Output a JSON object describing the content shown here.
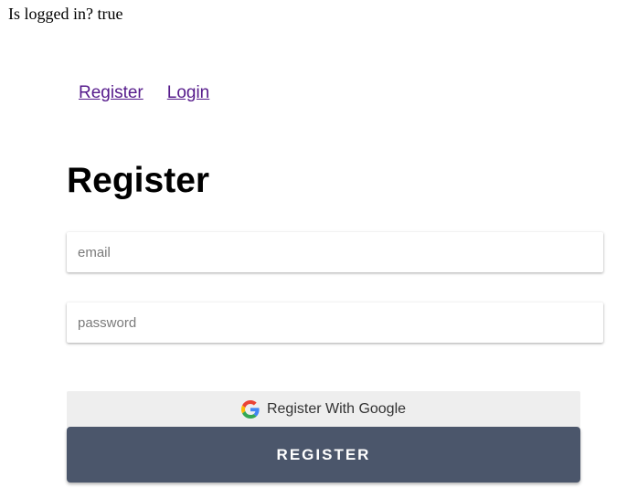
{
  "status": {
    "text": "Is logged in? true"
  },
  "nav": {
    "register_label": "Register",
    "login_label": "Login",
    "link_color": "#551a8b"
  },
  "form": {
    "title": "Register",
    "email_placeholder": "email",
    "password_placeholder": "password",
    "google_button_label": "Register With Google",
    "register_button_label": "REGISTER",
    "register_button_color": "#4b566b",
    "google_button_color": "#eeeeee"
  },
  "icons": {
    "google": "google-g-icon"
  }
}
